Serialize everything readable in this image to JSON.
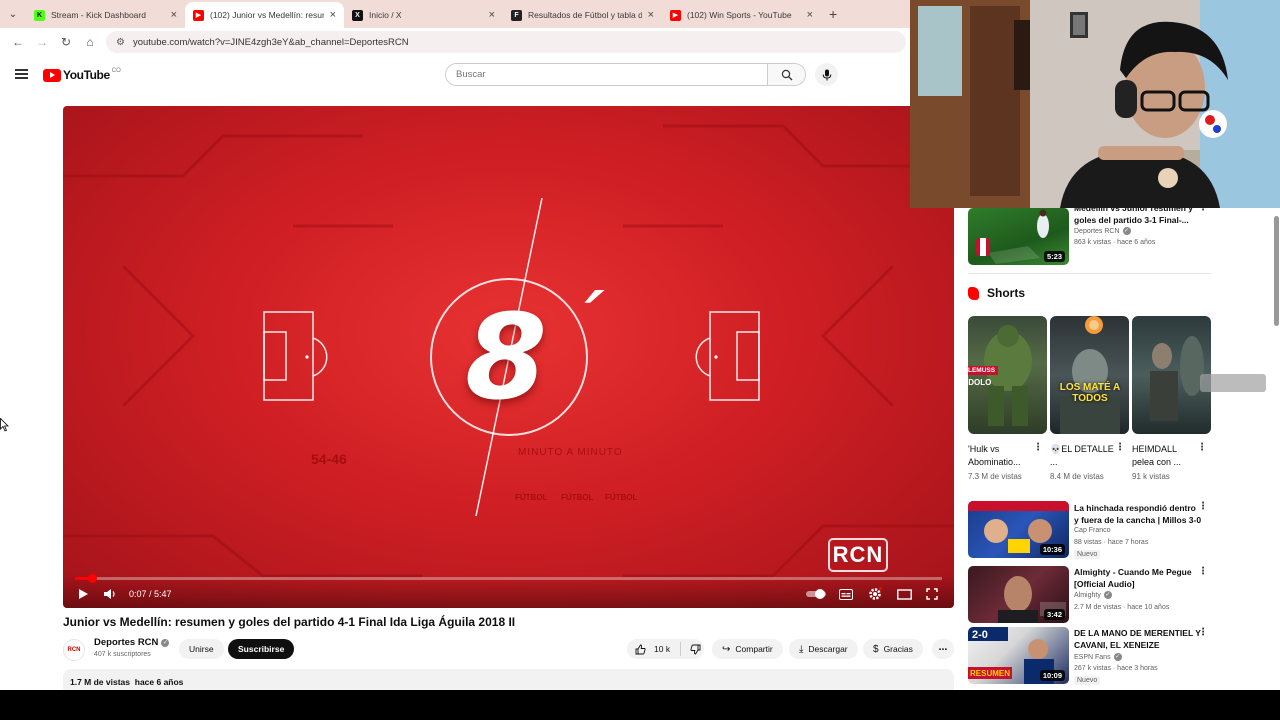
{
  "browser": {
    "tabs": [
      {
        "title": "Stream - Kick Dashboard",
        "favicon": "kick-icon",
        "color": "#53fc18",
        "glyph": "K",
        "active": false
      },
      {
        "title": "(102) Junior vs Medellín: resum...",
        "favicon": "youtube-icon",
        "color": "#ff0000",
        "glyph": "▶",
        "active": true
      },
      {
        "title": "Inicio / X",
        "favicon": "x-icon",
        "color": "#111111",
        "glyph": "X",
        "active": false
      },
      {
        "title": "Resultados de Fútbol y tabla de...",
        "favicon": "flashscore-icon",
        "color": "#222222",
        "glyph": "F",
        "active": false
      },
      {
        "title": "(102) Win Sports - YouTube",
        "favicon": "youtube-icon",
        "color": "#ff0000",
        "glyph": "▶",
        "active": false
      }
    ],
    "url": "youtube.com/watch?v=JINE4zgh3eY&ab_channel=DeportesRCN"
  },
  "youtube": {
    "logo_text": "YouTube",
    "country_code": "CO",
    "search_placeholder": "Buscar"
  },
  "player": {
    "minute_number": "8",
    "minute_label": "MINUTO A MINUTO",
    "score_overlay": "54-46",
    "overlay_words": [
      "FÚTBOL",
      "FÚTBOL",
      "FÚTBOL"
    ],
    "broadcaster_logo": "RCN",
    "current_time": "0:07",
    "duration": "5:47",
    "time_separator": " / ",
    "progress_fraction": 0.02
  },
  "video": {
    "title": "Junior vs Medellín: resumen y goles del partido 4-1 Final Ida Liga Águila 2018 II",
    "channel": "Deportes RCN",
    "subscribers": "407 k suscriptores",
    "join_label": "Unirse",
    "subscribe_label": "Suscribirse",
    "likes": "10 k",
    "share_label": "Compartir",
    "download_label": "Descargar",
    "thanks_label": "Gracias",
    "views": "1.7 M de vistas",
    "age": "hace 6 años"
  },
  "sidebar": {
    "top_rec": {
      "title": "Medellín vs Junior resumen y goles del partido 3-1 Final-...",
      "channel": "Deportes RCN",
      "meta": "863 k vistas · hace 6 años",
      "duration": "5:23"
    },
    "shorts_heading": "Shorts",
    "shorts": [
      {
        "title": "'Hulk vs Abominatio...",
        "views": "7.3 M de vistas",
        "badge": "LEMUSS",
        "caption": "ÍDOLO"
      },
      {
        "title": "💀EL DETALLE ...",
        "views": "8.4 M de vistas",
        "caption": "LOS MATÉ A TODOS"
      },
      {
        "title": "HEIMDALL pelea con ...",
        "views": "91 k vistas"
      }
    ],
    "recs": [
      {
        "title": "La hinchada respondió dentro y fuera de la cancha | Millos 3-0 ...",
        "channel": "Cap Franco",
        "meta": "88 vistas · hace 7 horas",
        "badge": "Nuevo",
        "duration": "10:36"
      },
      {
        "title": "Almighty - Cuando Me Pegue [Official Audio]",
        "channel": "Almighty",
        "meta": "2.7 M de vistas · hace 10 años",
        "duration": "3:42"
      },
      {
        "title": "DE LA MANO DE MERENTIEL Y CAVANI, EL XENEIZE FESTEJÓ...",
        "channel": "ESPN Fans",
        "meta": "267 k vistas · hace 3 horas",
        "badge": "Nuevo",
        "duration": "10:09"
      }
    ]
  },
  "colors": {
    "accent": "#ff0000",
    "player_red": "#cf1f24"
  }
}
